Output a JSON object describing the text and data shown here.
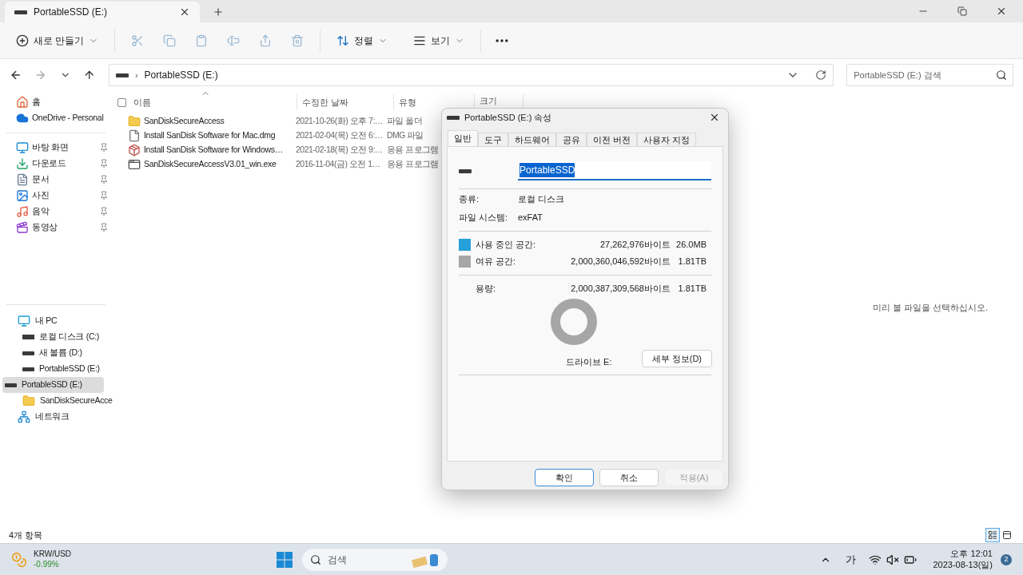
{
  "window": {
    "tab": {
      "title": "PortableSSD (E:)"
    }
  },
  "toolbar": {
    "new_label": "새로 만들기",
    "sort_label": "정렬",
    "view_label": "보기"
  },
  "address": {
    "separator": "›",
    "crumb": "PortableSSD (E:)",
    "search_placeholder": "PortableSSD (E:) 검색"
  },
  "sidebar": {
    "quick": [
      {
        "kind": "home",
        "label": "홈"
      },
      {
        "kind": "cloud",
        "label": "OneDrive - Personal"
      }
    ],
    "pinned": [
      {
        "kind": "desktop",
        "label": "바탕 화면",
        "pinned": true
      },
      {
        "kind": "download",
        "label": "다운로드",
        "pinned": true
      },
      {
        "kind": "document",
        "label": "문서",
        "pinned": true
      },
      {
        "kind": "picture",
        "label": "사진",
        "pinned": true
      },
      {
        "kind": "music",
        "label": "음악",
        "pinned": true
      },
      {
        "kind": "video",
        "label": "동영상",
        "pinned": true
      }
    ],
    "tree": [
      {
        "kind": "pc",
        "label": "내 PC",
        "selected": false,
        "children": [
          {
            "kind": "disk",
            "label": "로컬 디스크 (C:)",
            "selected": false
          },
          {
            "kind": "drive",
            "label": "새 볼륨 (D:)",
            "selected": false
          },
          {
            "kind": "drive",
            "label": "PortableSSD (E:)",
            "selected": false
          }
        ]
      },
      {
        "kind": "drive",
        "label": "PortableSSD (E:)",
        "selected": true,
        "children": [
          {
            "kind": "folder",
            "label": "SanDiskSecureAcce",
            "selected": false
          }
        ]
      },
      {
        "kind": "network",
        "label": "네트워크",
        "selected": false
      }
    ]
  },
  "table": {
    "select_all_checked": false,
    "columns": [
      "이름",
      "수정한 날짜",
      "유형",
      "크기"
    ],
    "rows": [
      {
        "kind": "folder",
        "name": "SanDiskSecureAccess",
        "date": "2021-10-26(화) 오후 7:…",
        "type": "파일 폴더"
      },
      {
        "kind": "file",
        "name": "Install SanDisk Software for Mac.dmg",
        "date": "2021-02-04(목) 오전 6:…",
        "type": "DMG 파일"
      },
      {
        "kind": "installer",
        "name": "Install SanDisk Software for Windows…",
        "date": "2021-02-18(목) 오전 9:…",
        "type": "응용 프로그램"
      },
      {
        "kind": "exe",
        "name": "SanDiskSecureAccessV3.01_win.exe",
        "date": "2016-11-04(금) 오전 1…",
        "type": "응용 프로그램"
      }
    ]
  },
  "preview": {
    "message": "미리 볼 파일을 선택하십시오."
  },
  "status_bar": {
    "count": "4개 항목",
    "views": [
      {
        "kind": "details",
        "selected": true
      },
      {
        "kind": "tiles",
        "selected": false
      }
    ]
  },
  "dialog": {
    "title": "PortableSSD (E:) 속성",
    "tabs": [
      {
        "label": "일반",
        "selected": true
      },
      {
        "label": "도구",
        "selected": false
      },
      {
        "label": "하드웨어",
        "selected": false
      },
      {
        "label": "공유",
        "selected": false
      },
      {
        "label": "이전 버전",
        "selected": false
      },
      {
        "label": "사용자 지정",
        "selected": false
      }
    ],
    "name_value": "PortableSSD",
    "name_selected": true,
    "info": [
      {
        "label": "종류:",
        "value": "로컬 디스크"
      },
      {
        "label": "파일 시스템:",
        "value": "exFAT"
      }
    ],
    "space": [
      {
        "label": "사용 중인 공간:",
        "bytes": "27,262,976바이트",
        "size": "26.0MB",
        "color": "#26a0da"
      },
      {
        "label": "여유 공간:",
        "bytes": "2,000,360,046,592바이트",
        "size": "1.81TB",
        "color": "#a6a6a6"
      }
    ],
    "capacity": {
      "label": "용량:",
      "bytes": "2,000,387,309,568바이트",
      "size": "1.81TB"
    },
    "drive_label": "드라이브 E:",
    "details_button": "세부 정보(D)",
    "buttons": [
      {
        "label": "확인",
        "default": true,
        "disabled": false
      },
      {
        "label": "취소",
        "default": false,
        "disabled": false
      },
      {
        "label": "적용(A)",
        "default": false,
        "disabled": true
      }
    ]
  },
  "taskbar": {
    "widget": {
      "title": "KRW/USD",
      "change": "-0.99%"
    },
    "search_placeholder": "검색",
    "ime": "가",
    "time": "오후 12:01",
    "date": "2023-08-13(일)",
    "badge": "2"
  }
}
